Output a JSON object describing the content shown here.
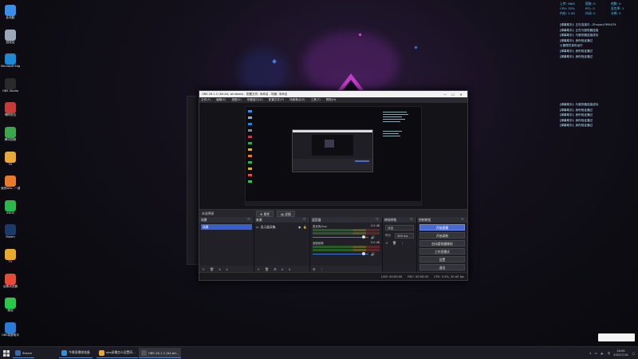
{
  "desktop_icons": [
    {
      "label": "此电脑",
      "color": "#3a8ee8"
    },
    {
      "label": "回收站",
      "color": "#9aa8b8"
    },
    {
      "label": "Microsoft Edge",
      "color": "#1e88d8"
    },
    {
      "label": "OBS Studio",
      "color": "#2a2a2a"
    },
    {
      "label": "嘿哔抢位",
      "color": "#c83a3a"
    },
    {
      "label": "腾讯视频",
      "color": "#3aa84a"
    },
    {
      "label": "FX",
      "color": "#e8a83a"
    },
    {
      "label": "我的Win...一键重装",
      "color": "#e87a2a"
    },
    {
      "label": "XBOX",
      "color": "#2ab84a"
    },
    {
      "label": "Steam",
      "color": "#1a3a6a"
    },
    {
      "label": "TV",
      "color": "#e8a82a"
    },
    {
      "label": "谷歌浏览器",
      "color": "#e84a3a"
    },
    {
      "label": "微信",
      "color": "#2ac84a"
    },
    {
      "label": "OBS录屏助手",
      "color": "#2a7ad8"
    }
  ],
  "stats": [
    [
      "上传: 0B/S",
      "提取: 0",
      "帧数: 0"
    ],
    [
      "CPU: 32%",
      "RTL: 0",
      "丢包率: 1"
    ],
    [
      "内存: 2.0G",
      "抖动: 0",
      "分辨: 0"
    ]
  ],
  "log_top": [
    "[弹幕助手]: 正在连接中...Zhuyou1994474",
    "[弹幕助手]: 正在与服务器连接",
    "[弹幕助手]: 与服务器连接成功",
    "[弹幕助手]: 身份验证通过",
    "以管理员身份运行",
    "[弹幕助手]: 身份验证通过",
    "[弹幕助手]: 身份验证通过"
  ],
  "log_bottom": [
    "[弹幕助手]: 与服务器连接成功",
    "[弹幕助手]: 身份验证通过",
    "[弹幕助手]: 身份验证通过",
    "[弹幕助手]: 身份验证通过",
    "[弹幕助手]: 身份验证通过"
  ],
  "obs": {
    "title": "OBS 26.1.2 (64-bit, windows) - 配置文件: 未命名 - 场景: 未命名",
    "menu": [
      "文件(F)",
      "编辑(E)",
      "视图(V)",
      "停靠窗口(D)",
      "配置文件(P)",
      "场景集合(S)",
      "工具(T)",
      "帮助(H)"
    ],
    "source_bar": {
      "no_selection": "未选择源",
      "properties": "属性",
      "filters": "滤镜"
    },
    "scenes": {
      "header": "场景",
      "items": [
        "场景"
      ]
    },
    "sources": {
      "header": "来源",
      "items": [
        "显示器采集"
      ]
    },
    "mixer": {
      "header": "混音器",
      "channels": [
        {
          "name": "麦克风/Aux",
          "db": "0.0 dB"
        },
        {
          "name": "桌面音频",
          "db": "0.0 dB"
        }
      ]
    },
    "transitions": {
      "header": "转场特效",
      "type": "淡出",
      "duration_label": "时长",
      "duration": "300 ms"
    },
    "controls": {
      "header": "控制按钮",
      "buttons": [
        "开始直播",
        "开始录制",
        "启动虚拟摄像机",
        "工作室模式",
        "设置",
        "退出"
      ]
    },
    "status": {
      "live": "LIVE: 00:00:00",
      "rec": "REC: 00:00:00",
      "cpu": "CPU: 3.3%, 30.00 fps"
    }
  },
  "taskbar": {
    "items": [
      "Steam",
      "今晚直播前准备",
      "obs录播怎么设置同...",
      "OBS 26.1.2 (64-bit..."
    ],
    "time": "18:06",
    "date": "2022/7/16"
  }
}
